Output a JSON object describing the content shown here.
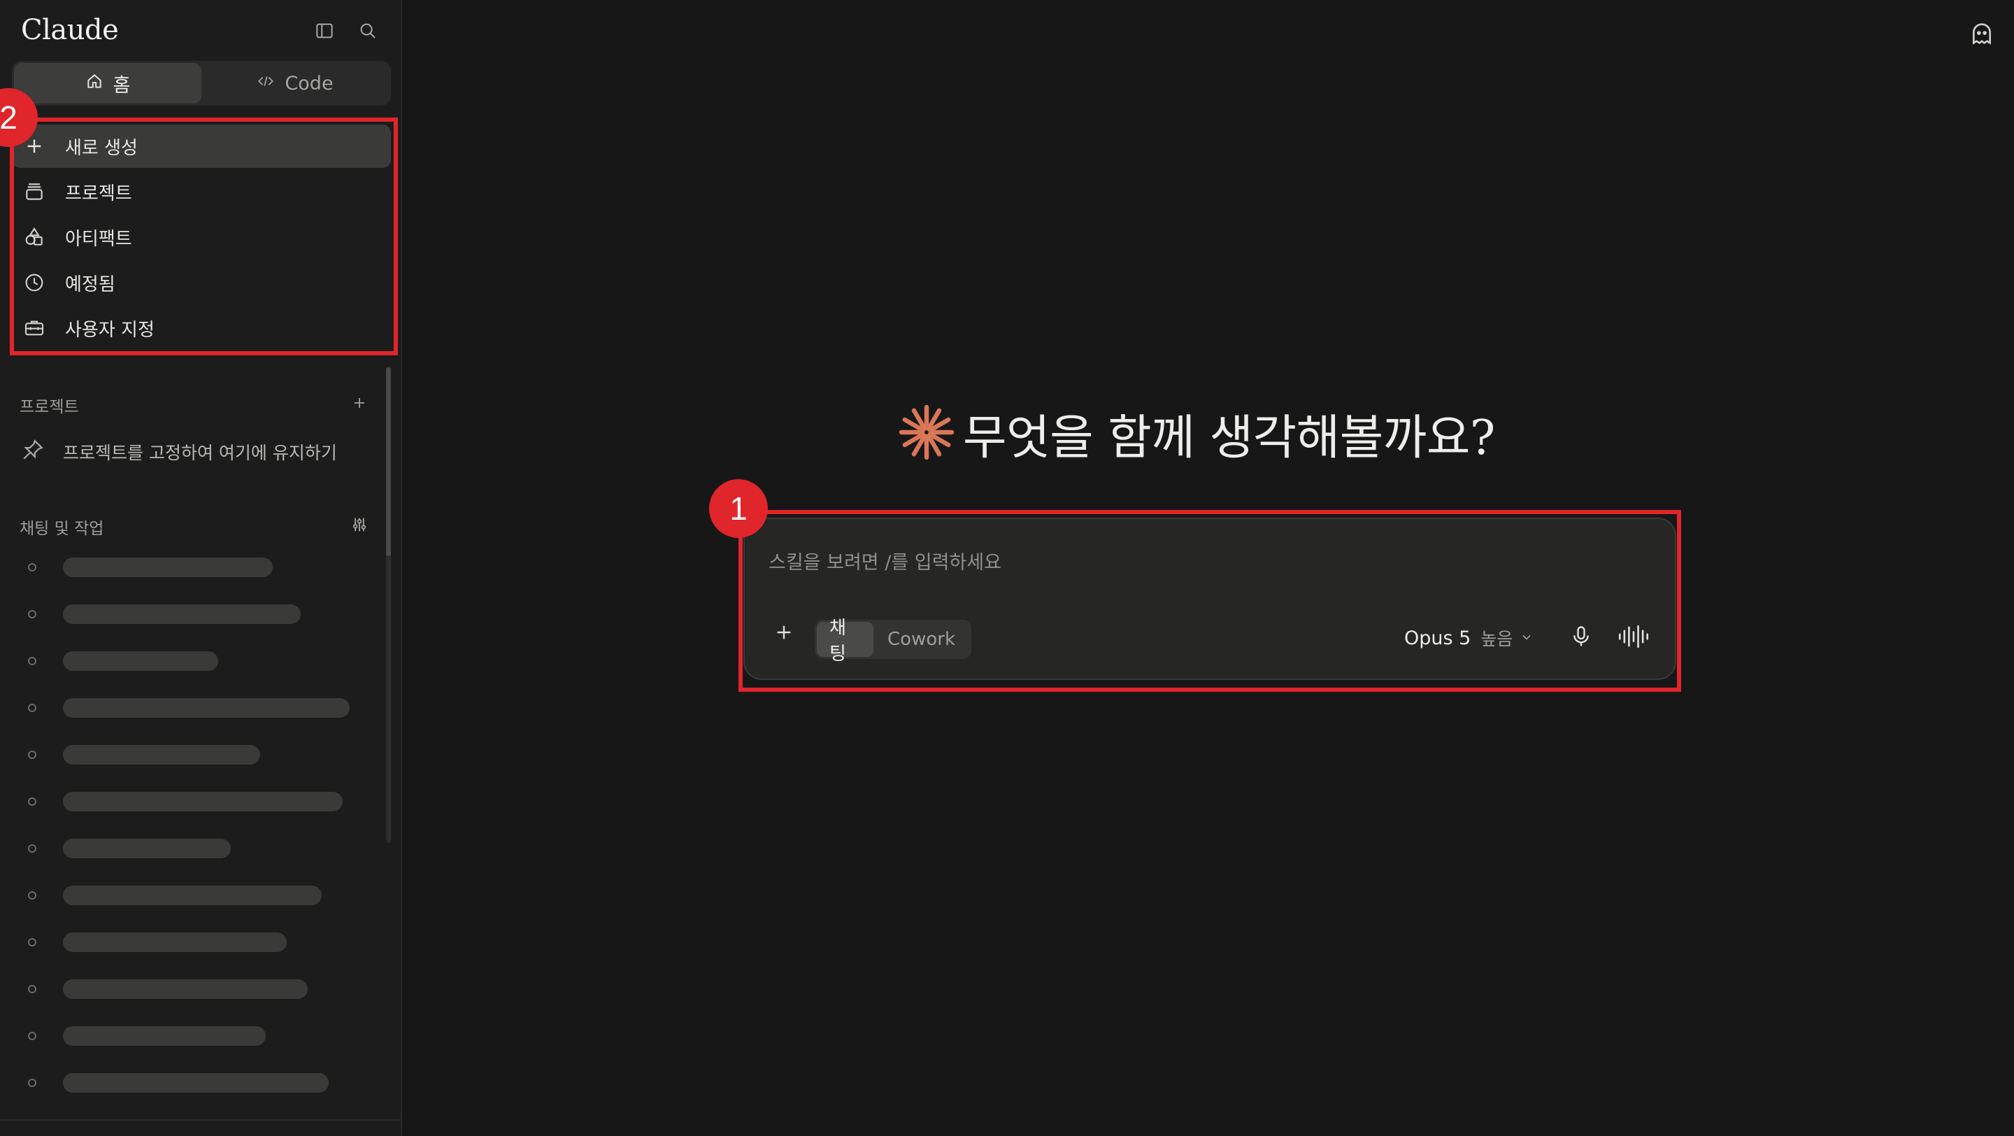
{
  "app": {
    "brand": "Claude"
  },
  "sidebar": {
    "modes": [
      {
        "label": "홈",
        "icon": "home-icon",
        "active": true
      },
      {
        "label": "Code",
        "icon": "code-icon",
        "active": false
      }
    ],
    "nav": [
      {
        "label": "새로 생성",
        "icon": "plus-icon",
        "active": true
      },
      {
        "label": "프로젝트",
        "icon": "projects-icon"
      },
      {
        "label": "아티팩트",
        "icon": "artifacts-icon"
      },
      {
        "label": "예정됨",
        "icon": "clock-icon"
      },
      {
        "label": "사용자 지정",
        "icon": "briefcase-icon"
      }
    ],
    "projects_header": "프로젝트",
    "pin_hint": "프로젝트를 고정하여 여기에 유지하기",
    "chats_header": "채팅 및 작업",
    "chat_placeholder_count": 12
  },
  "main": {
    "greeting": "무엇을 함께 생각해볼까요?",
    "composer": {
      "placeholder": "스킬을 보려면 /를 입력하세요",
      "modes": [
        {
          "label": "채팅",
          "active": true
        },
        {
          "label": "Cowork",
          "active": false
        }
      ],
      "model": "Opus 5",
      "effort": "높음"
    }
  },
  "annotations": [
    {
      "label": "1"
    },
    {
      "label": "2"
    }
  ],
  "colors": {
    "accent": "#d97757",
    "annotation": "#e0252b"
  }
}
